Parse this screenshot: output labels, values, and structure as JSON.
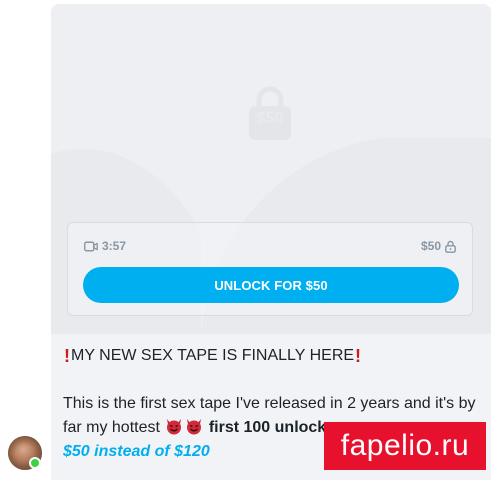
{
  "message": {
    "locked_price_label": "$50",
    "duration": "3:57",
    "price": "$50",
    "unlock_button_label": "UNLOCK FOR $50",
    "headline": "MY NEW SEX TAPE IS FINALLY HERE",
    "body_line_1": "This is the first sex tape I've released in 2 years and it's by",
    "body_line_2_start": "far my hottest",
    "body_line_2_bold": "first 100 unlock",
    "promo_price": "$50 instead of $120"
  },
  "icons": {
    "lock": "lock-icon",
    "video": "video-camera-icon",
    "devil": "smiling-devil-emoji",
    "exclamation": "red-exclamation-emoji"
  },
  "watermark": {
    "text": "fapelio.ru"
  },
  "colors": {
    "accent": "#00aff0",
    "online": "#3fd23f",
    "watermark_bg": "#e8112d",
    "text": "#1b2229",
    "muted": "#8a96a3"
  }
}
